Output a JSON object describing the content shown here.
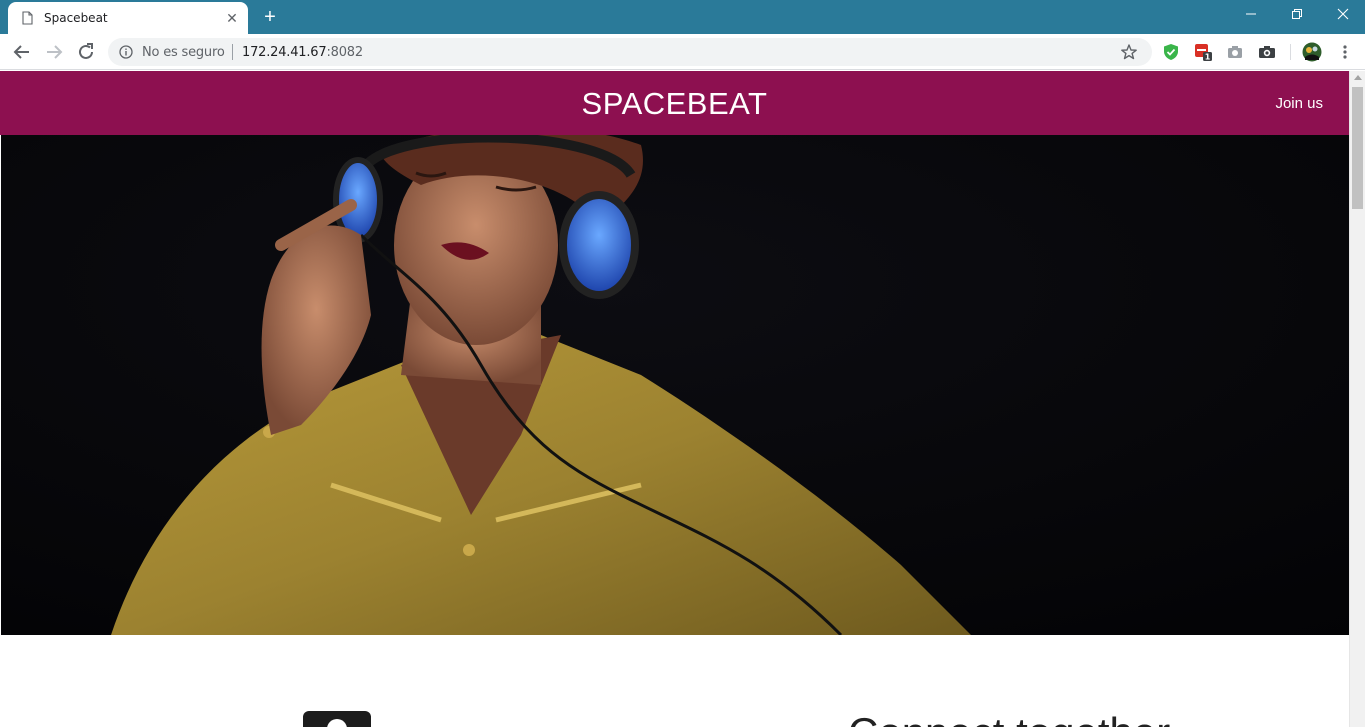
{
  "browser": {
    "tab_title": "Spacebeat",
    "new_tab_symbol": "+",
    "close_symbol": "✕",
    "window_controls": {
      "minimize": "—",
      "restore": "❐",
      "close": "✕"
    },
    "security_text": "No es seguro",
    "url_host": "172.24.41.67",
    "url_port": ":8082",
    "icons": [
      "back-icon",
      "forward-icon",
      "reload-icon",
      "info-icon",
      "star-icon",
      "shield-check-icon",
      "extension-badge-icon",
      "camera-icon",
      "camera-dark-icon",
      "profile-avatar-icon",
      "menu-kebab-icon"
    ],
    "extension_badge_count": "1"
  },
  "site": {
    "brand": "SPACEBEAT",
    "join_label": "Join us",
    "header_color": "#8d1050",
    "section_heading_partial": "Connect together"
  }
}
